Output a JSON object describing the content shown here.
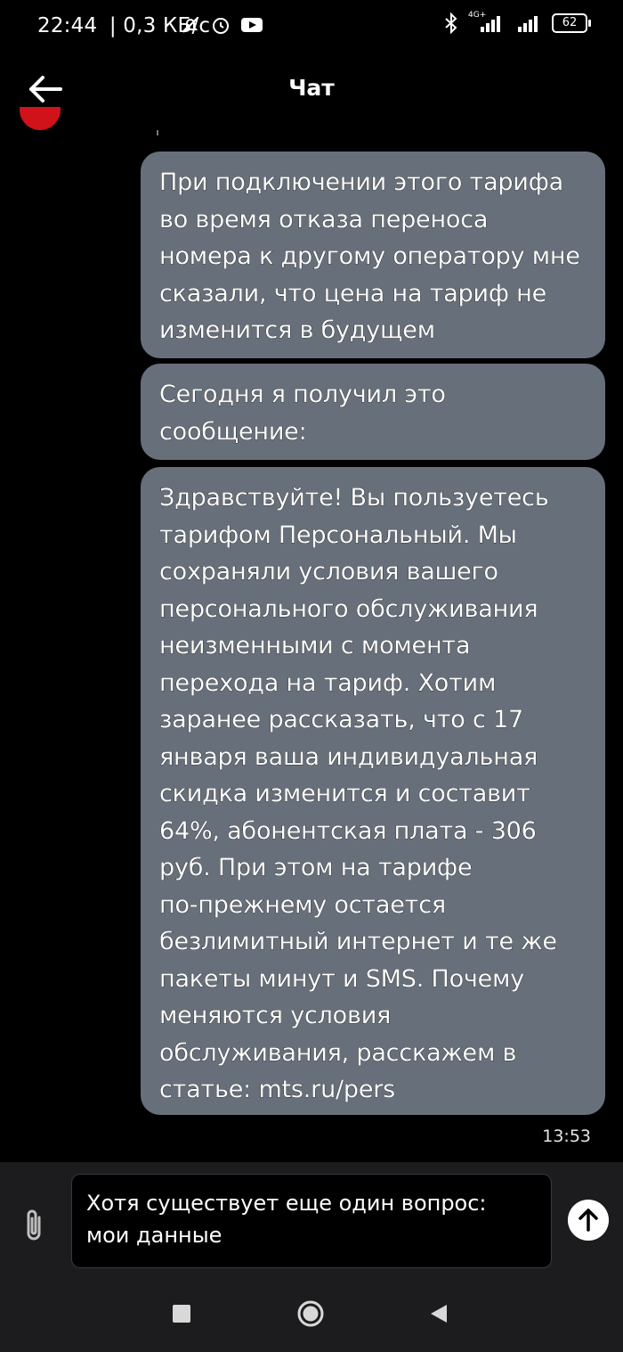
{
  "status_bar": {
    "time": "22:44",
    "speed": "| 0,3 КБ/с",
    "network_label": "4G+",
    "battery": "62"
  },
  "header": {
    "title": "Чат"
  },
  "messages": [
    {
      "text": "При подключении этого тарифа\nво время отказа переноса\nномера к другому оператору мне\nсказали, что цена на тариф не\nизменится в будущем"
    },
    {
      "text": "Сегодня я получил это\nсообщение:"
    },
    {
      "text": "Здравствуйте! Вы пользуетесь\nтарифом Персональный. Мы\nсохраняли условия вашего\nперсонального обслуживания\nнеизменными с момента\nперехода на тариф. Хотим\nзаранее рассказать, что с 17\nянваря ваша индивидуальная\nскидка изменится и составит\n64%, абонентская плата - 306\nруб. При этом на тарифе\nпо-прежнему остается\nбезлимитный интернет и те же\nпакеты минут и SMS. Почему\nменяются условия\nобслуживания, расскажем в\nстатье: mts.ru/pers"
    }
  ],
  "last_message_time": "13:53",
  "composer": {
    "value": "Хотя существует еще один вопрос:\nмои данные"
  },
  "colors": {
    "bubble": "#676f7a",
    "background": "#000000",
    "composer_bg": "#1c1c1e",
    "avatar": "#d0121b"
  }
}
